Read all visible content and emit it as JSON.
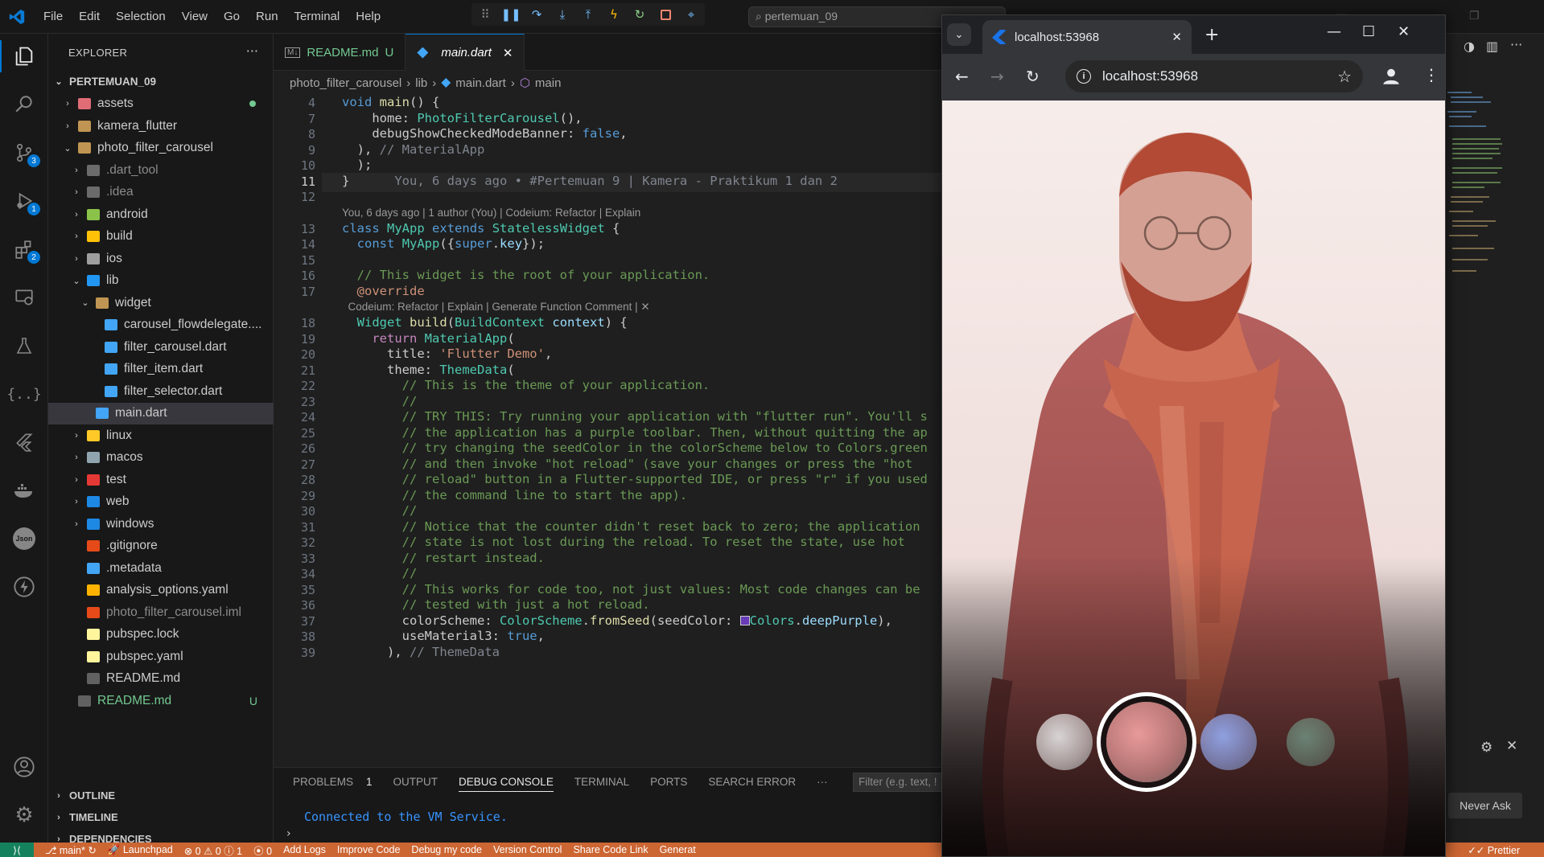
{
  "vscode": {
    "menu": [
      "File",
      "Edit",
      "Selection",
      "View",
      "Go",
      "Run",
      "Terminal",
      "Help"
    ],
    "command_center": "pertemuan_09",
    "explorer": {
      "title": "EXPLORER",
      "root": "PERTEMUAN_09",
      "tree": [
        {
          "label": "assets",
          "indent": 1,
          "chevron": "right",
          "icon": "#e06c75",
          "dot": true
        },
        {
          "label": "kamera_flutter",
          "indent": 1,
          "chevron": "right",
          "icon": "#c09553"
        },
        {
          "label": "photo_filter_carousel",
          "indent": 1,
          "chevron": "down",
          "icon": "#c09553"
        },
        {
          "label": ".dart_tool",
          "indent": 2,
          "chevron": "right",
          "icon": "#6b6b6b",
          "dim": true
        },
        {
          "label": ".idea",
          "indent": 2,
          "chevron": "right",
          "icon": "#6b6b6b",
          "dim": true
        },
        {
          "label": "android",
          "indent": 2,
          "chevron": "right",
          "icon": "#8bc34a"
        },
        {
          "label": "build",
          "indent": 2,
          "chevron": "right",
          "icon": "#ffc107"
        },
        {
          "label": "ios",
          "indent": 2,
          "chevron": "right",
          "icon": "#9e9e9e"
        },
        {
          "label": "lib",
          "indent": 2,
          "chevron": "down",
          "icon": "#2196f3"
        },
        {
          "label": "widget",
          "indent": 3,
          "chevron": "down",
          "icon": "#c09553"
        },
        {
          "label": "carousel_flowdelegate....",
          "indent": 4,
          "icon": "#42a5f5"
        },
        {
          "label": "filter_carousel.dart",
          "indent": 4,
          "icon": "#42a5f5"
        },
        {
          "label": "filter_item.dart",
          "indent": 4,
          "icon": "#42a5f5"
        },
        {
          "label": "filter_selector.dart",
          "indent": 4,
          "icon": "#42a5f5"
        },
        {
          "label": "main.dart",
          "indent": 3,
          "icon": "#42a5f5",
          "selected": true
        },
        {
          "label": "linux",
          "indent": 2,
          "chevron": "right",
          "icon": "#ffca28"
        },
        {
          "label": "macos",
          "indent": 2,
          "chevron": "right",
          "icon": "#90a4ae"
        },
        {
          "label": "test",
          "indent": 2,
          "chevron": "right",
          "icon": "#e53935"
        },
        {
          "label": "web",
          "indent": 2,
          "chevron": "right",
          "icon": "#1e88e5"
        },
        {
          "label": "windows",
          "indent": 2,
          "chevron": "right",
          "icon": "#1e88e5"
        },
        {
          "label": ".gitignore",
          "indent": 2,
          "icon": "#e64a19"
        },
        {
          "label": ".metadata",
          "indent": 2,
          "icon": "#42a5f5"
        },
        {
          "label": "analysis_options.yaml",
          "indent": 2,
          "icon": "#ffb300"
        },
        {
          "label": "photo_filter_carousel.iml",
          "indent": 2,
          "icon": "#e64a19",
          "dim": true
        },
        {
          "label": "pubspec.lock",
          "indent": 2,
          "icon": "#fff59d"
        },
        {
          "label": "pubspec.yaml",
          "indent": 2,
          "icon": "#fff59d"
        },
        {
          "label": "README.md",
          "indent": 2,
          "icon": "#616161"
        },
        {
          "label": "README.md",
          "indent": 1,
          "icon": "#616161",
          "untracked": "U"
        }
      ],
      "sections": [
        "OUTLINE",
        "TIMELINE",
        "DEPENDENCIES"
      ]
    },
    "tabs": [
      {
        "label": "README.md",
        "badge": "U"
      },
      {
        "label": "main.dart"
      }
    ],
    "breadcrumb": [
      "photo_filter_carousel",
      "lib",
      "main.dart",
      "main"
    ],
    "code": {
      "lines": [
        {
          "n": "4",
          "html": "<span class='kb'>void</span> <span class='f'>main</span>() {"
        },
        {
          "n": "7",
          "html": "    home: <span class='t'>PhotoFilterCarousel</span>(),"
        },
        {
          "n": "8",
          "html": "    debugShowCheckedModeBanner: <span class='kb'>false</span>,"
        },
        {
          "n": "9",
          "html": "  ), <span class='g'>// MaterialApp</span>"
        },
        {
          "n": "10",
          "html": "  );"
        },
        {
          "n": "11",
          "html": "}      <span class='g'>You, 6 days ago • #Pertemuan 9 | Kamera - Praktikum 1 dan 2</span>",
          "current": true
        },
        {
          "n": "12",
          "html": ""
        },
        {
          "lens": "You, 6 days ago | 1 author (You) | Codeium: Refactor | Explain"
        },
        {
          "n": "13",
          "html": "<span class='kb'>class</span> <span class='t'>MyApp</span> <span class='kb'>extends</span> <span class='t'>StatelessWidget</span> {"
        },
        {
          "n": "14",
          "html": "  <span class='kb'>const</span> <span class='t'>MyApp</span>({<span class='kb'>super</span>.<span class='p'>key</span>});"
        },
        {
          "n": "15",
          "html": ""
        },
        {
          "n": "16",
          "html": "  <span class='c'>// This widget is the root of your application.</span>"
        },
        {
          "n": "17",
          "html": "  <span class='s'>@override</span>"
        },
        {
          "lens": "  Codeium: Refactor | Explain | Generate Function Comment | ✕"
        },
        {
          "n": "18",
          "html": "  <span class='t'>Widget</span> <span class='f'>build</span>(<span class='t'>BuildContext</span> <span class='p'>context</span>) {"
        },
        {
          "n": "19",
          "html": "    <span class='k'>return</span> <span class='t'>MaterialApp</span>("
        },
        {
          "n": "20",
          "html": "      title: <span class='s'>'Flutter Demo'</span>,"
        },
        {
          "n": "21",
          "html": "      theme: <span class='t'>ThemeData</span>("
        },
        {
          "n": "22",
          "html": "        <span class='c'>// This is the theme of your application.</span>"
        },
        {
          "n": "23",
          "html": "        <span class='c'>//</span>"
        },
        {
          "n": "24",
          "html": "        <span class='c'>// TRY THIS: Try running your application with \"flutter run\". You'll s</span>"
        },
        {
          "n": "25",
          "html": "        <span class='c'>// the application has a purple toolbar. Then, without quitting the ap</span>"
        },
        {
          "n": "26",
          "html": "        <span class='c'>// try changing the seedColor in the colorScheme below to Colors.green</span>"
        },
        {
          "n": "27",
          "html": "        <span class='c'>// and then invoke \"hot reload\" (save your changes or press the \"hot</span>"
        },
        {
          "n": "28",
          "html": "        <span class='c'>// reload\" button in a Flutter-supported IDE, or press \"r\" if you used</span>"
        },
        {
          "n": "29",
          "html": "        <span class='c'>// the command line to start the app).</span>"
        },
        {
          "n": "30",
          "html": "        <span class='c'>//</span>"
        },
        {
          "n": "31",
          "html": "        <span class='c'>// Notice that the counter didn't reset back to zero; the application</span>"
        },
        {
          "n": "32",
          "html": "        <span class='c'>// state is not lost during the reload. To reset the state, use hot</span>"
        },
        {
          "n": "33",
          "html": "        <span class='c'>// restart instead.</span>"
        },
        {
          "n": "34",
          "html": "        <span class='c'>//</span>"
        },
        {
          "n": "35",
          "html": "        <span class='c'>// This works for code too, not just values: Most code changes can be</span>"
        },
        {
          "n": "36",
          "html": "        <span class='c'>// tested with just a hot reload.</span>"
        },
        {
          "n": "37",
          "html": "        colorScheme: <span class='t'>ColorScheme</span>.<span class='f'>fromSeed</span>(seedColor: <span style='display:inline-block;width:12px;height:12px;background:#673ab7;border:1px solid #ccc;vertical-align:-1px'></span><span class='t'>Colors</span>.<span class='p'>deepPurple</span>),"
        },
        {
          "n": "38",
          "html": "        useMaterial3: <span class='kb'>true</span>,"
        },
        {
          "n": "39",
          "html": "      ), <span class='g'>// ThemeData</span>"
        }
      ]
    },
    "panel": {
      "tabs": [
        "PROBLEMS",
        "OUTPUT",
        "DEBUG CONSOLE",
        "TERMINAL",
        "PORTS",
        "SEARCH ERROR"
      ],
      "problems_count": "1",
      "filter_placeholder": "Filter (e.g. text, !",
      "console_text": "Connected to the VM Service."
    },
    "statusbar": [
      "main*",
      "Launchpad",
      "⊗ 0 ⚠ 0 ⓘ 1",
      "0",
      "Add Logs",
      "Improve Code",
      "Debug my code",
      "Version Control",
      "Share Code Link",
      "Generat",
      "Prettier"
    ],
    "never_ask": "Never Ask",
    "activity_badges": {
      "scm": "3",
      "debug": "1",
      "extensions": "2"
    }
  },
  "browser": {
    "tab_title": "localhost:53968",
    "url": "localhost:53968",
    "filters": [
      "#d8d4d4",
      "#e89a9a",
      "#8fa0e0",
      "#7fbfa8"
    ],
    "selected_filter_index": 1
  },
  "colors": {
    "status": "#cc6633",
    "accent": "#0078d4",
    "editor_bg": "#1f1f1f"
  }
}
